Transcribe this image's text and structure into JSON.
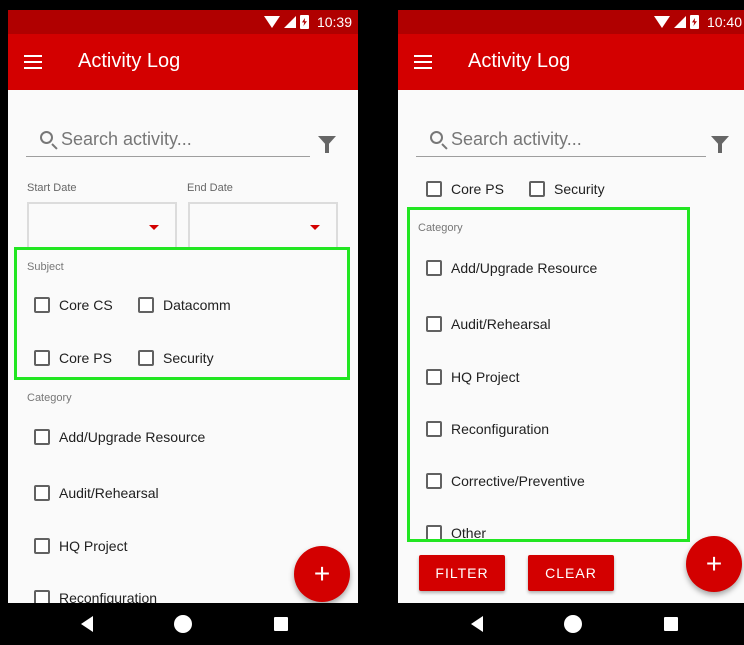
{
  "screens": [
    {
      "status_time": "10:39",
      "app_title": "Activity Log",
      "search_placeholder": "Search activity...",
      "start_date_label": "Start Date",
      "end_date_label": "End Date",
      "subject_label": "Subject",
      "subject_options": [
        "Core CS",
        "Datacomm",
        "Core PS",
        "Security"
      ],
      "category_label": "Category",
      "category_options": [
        "Add/Upgrade Resource",
        "Audit/Rehearsal",
        "HQ Project",
        "Reconfiguration"
      ],
      "fab_icon": "add-icon",
      "fab_glyph": "+"
    },
    {
      "status_time": "10:40",
      "app_title": "Activity Log",
      "search_placeholder": "Search activity...",
      "subject_options_partial": [
        "Core PS",
        "Security"
      ],
      "category_label": "Category",
      "category_options": [
        "Add/Upgrade Resource",
        "Audit/Rehearsal",
        "HQ Project",
        "Reconfiguration",
        "Corrective/Preventive",
        "Other"
      ],
      "filter_button_label": "FILTER",
      "clear_button_label": "CLEAR",
      "fab_icon": "add-icon",
      "fab_glyph": "+"
    }
  ],
  "colors": {
    "status_bar": "#b00000",
    "app_bar": "#d30000",
    "accent": "#d30000",
    "highlight": "#22e622",
    "background": "#fafafa"
  }
}
